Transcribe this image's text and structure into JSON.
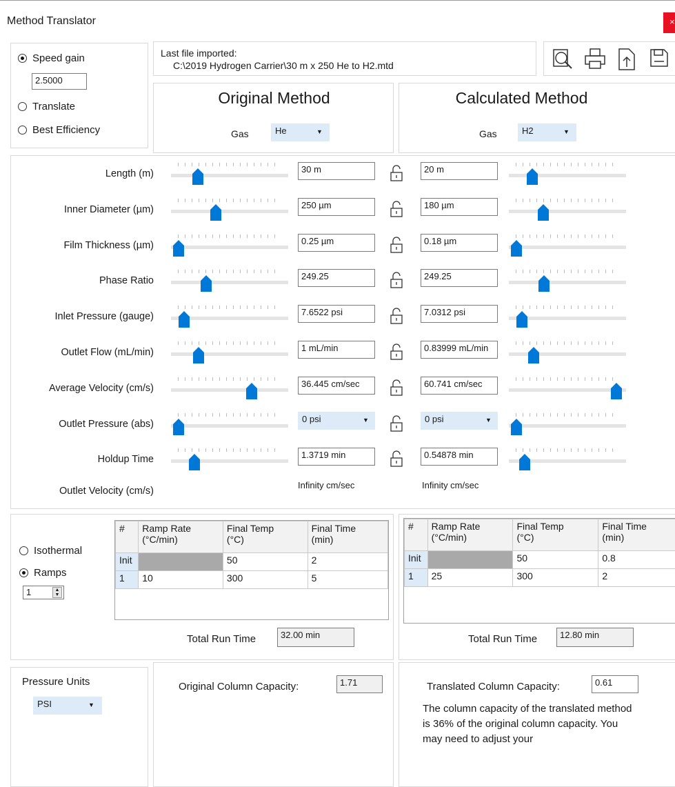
{
  "window": {
    "title": "Method Translator",
    "close_glyph": "×"
  },
  "mode": {
    "options": [
      "Speed gain",
      "Translate",
      "Best Efficiency"
    ],
    "selected": "Speed gain",
    "speed_gain_value": "2.5000"
  },
  "last_file": {
    "label": "Last file imported:",
    "path": "C:\\2019 Hydrogen Carrier\\30 m x 250 He to H2.mtd"
  },
  "toolbar_icons": [
    "search-icon",
    "print-icon",
    "export-icon",
    "save-icon"
  ],
  "original": {
    "heading": "Original Method",
    "gas_label": "Gas",
    "gas": "He"
  },
  "calculated": {
    "heading": "Calculated Method",
    "gas_label": "Gas",
    "gas": "H2"
  },
  "params": [
    {
      "label": "Length (m)",
      "orig": "30 m",
      "calc": "20 m",
      "orig_level": 0.2,
      "calc_level": 0.17
    },
    {
      "label": "Inner Diameter (µm)",
      "orig": "250 µm",
      "calc": "180 µm",
      "orig_level": 0.37,
      "calc_level": 0.27
    },
    {
      "label": "Film Thickness (µm)",
      "orig": "0.25 µm",
      "calc": "0.18 µm",
      "orig_level": 0.02,
      "calc_level": 0.02
    },
    {
      "label": "Phase Ratio",
      "orig": "249.25",
      "calc": "249.25",
      "orig_level": 0.28,
      "calc_level": 0.28
    },
    {
      "label": "Inlet Pressure (gauge)",
      "orig": "7.6522 psi",
      "calc": "7.0312 psi",
      "orig_level": 0.07,
      "calc_level": 0.07
    },
    {
      "label": "Outlet Flow (mL/min)",
      "orig": "1 mL/min",
      "calc": "0.83999 mL/min",
      "orig_level": 0.21,
      "calc_level": 0.18
    },
    {
      "label": "Average Velocity (cm/s)",
      "orig": "36.445 cm/sec",
      "calc": "60.741 cm/sec",
      "orig_level": 0.71,
      "calc_level": 0.96
    },
    {
      "label": "Outlet Pressure (abs)",
      "orig": "0 psi",
      "calc": "0 psi",
      "orig_level": 0.02,
      "calc_level": 0.02,
      "is_combo": true
    },
    {
      "label": "Holdup Time",
      "orig": "1.3719 min",
      "calc": "0.54878 min",
      "orig_level": 0.17,
      "calc_level": 0.1
    }
  ],
  "outlet_velocity": {
    "label": "Outlet Velocity (cm/s)",
    "orig": "Infinity cm/sec",
    "calc": "Infinity cm/sec"
  },
  "temperature": {
    "options": [
      "Isothermal",
      "Ramps"
    ],
    "selected": "Ramps",
    "ramps_count": "1"
  },
  "ramp_table": {
    "headers": [
      "#",
      "Ramp Rate\n(°C/min)",
      "Final Temp\n(°C)",
      "Final Time\n(min)"
    ],
    "original_rows": [
      [
        "Init",
        "",
        "50",
        "2"
      ],
      [
        "1",
        "10",
        "300",
        "5"
      ]
    ],
    "calculated_rows": [
      [
        "Init",
        "",
        "50",
        "0.8"
      ],
      [
        "1",
        "25",
        "300",
        "2"
      ]
    ]
  },
  "run_time": {
    "label": "Total Run Time",
    "original": "32.00 min",
    "calculated": "12.80 min"
  },
  "pressure_units": {
    "label": "Pressure Units",
    "value": "PSI"
  },
  "capacity": {
    "original_label": "Original Column Capacity:",
    "original_value": "1.71",
    "translated_label": "Translated Column Capacity:",
    "translated_value": "0.61",
    "message": "The column capacity of the translated method is 36% of the original column capacity.  You may need to adjust your"
  },
  "colors": {
    "accent": "#0078d7",
    "close": "#e81123",
    "combo_bg": "#dcebf7"
  }
}
